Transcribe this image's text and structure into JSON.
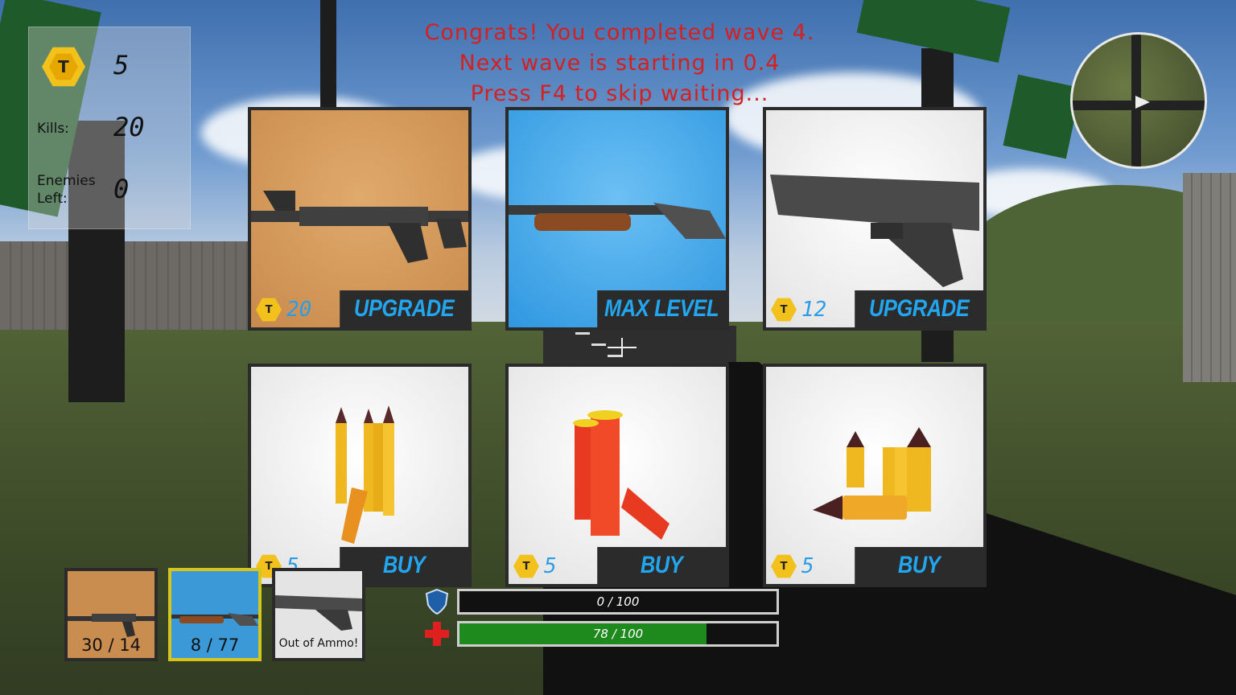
{
  "hud": {
    "coins": "5",
    "coin_letter": "T",
    "kills_label": "Kills:",
    "kills": "20",
    "enemies_label_1": "Enemies",
    "enemies_label_2": "Left:",
    "enemies_left": "0"
  },
  "wave_message": {
    "line1": "Congrats! You completed wave 4.",
    "line2": "Next wave is starting in 0.4",
    "line3": "Press F4 to skip waiting..."
  },
  "shop": {
    "currency_letter": "T",
    "weapons": [
      {
        "name": "assault-rifle",
        "price": "20",
        "action": "UPGRADE",
        "bg": "#d39a5a"
      },
      {
        "name": "shotgun",
        "price": "",
        "action": "MAX LEVEL",
        "bg": "#3fa6ea"
      },
      {
        "name": "pistol",
        "price": "12",
        "action": "UPGRADE",
        "bg": "#efefef"
      }
    ],
    "ammo": [
      {
        "name": "rifle-ammo",
        "price": "5",
        "action": "BUY"
      },
      {
        "name": "shotgun-shells",
        "price": "5",
        "action": "BUY"
      },
      {
        "name": "pistol-ammo",
        "price": "5",
        "action": "BUY"
      }
    ]
  },
  "inventory": [
    {
      "name": "assault-rifle",
      "ammo": "30 / 14",
      "active": false
    },
    {
      "name": "shotgun",
      "ammo": "8 / 77",
      "active": true
    },
    {
      "name": "pistol",
      "ammo": "Out of Ammo!",
      "active": false
    }
  ],
  "armor": {
    "text": "0 / 100",
    "value": 0,
    "max": 100,
    "icon": "shield-icon"
  },
  "health": {
    "text": "78 / 100",
    "value": 78,
    "max": 100,
    "icon": "health-cross-icon"
  },
  "colors": {
    "accent_blue": "#22a6f0",
    "warning_red": "#d42020",
    "coin_gold": "#f3c11b",
    "health_green": "#1e8a1e"
  }
}
